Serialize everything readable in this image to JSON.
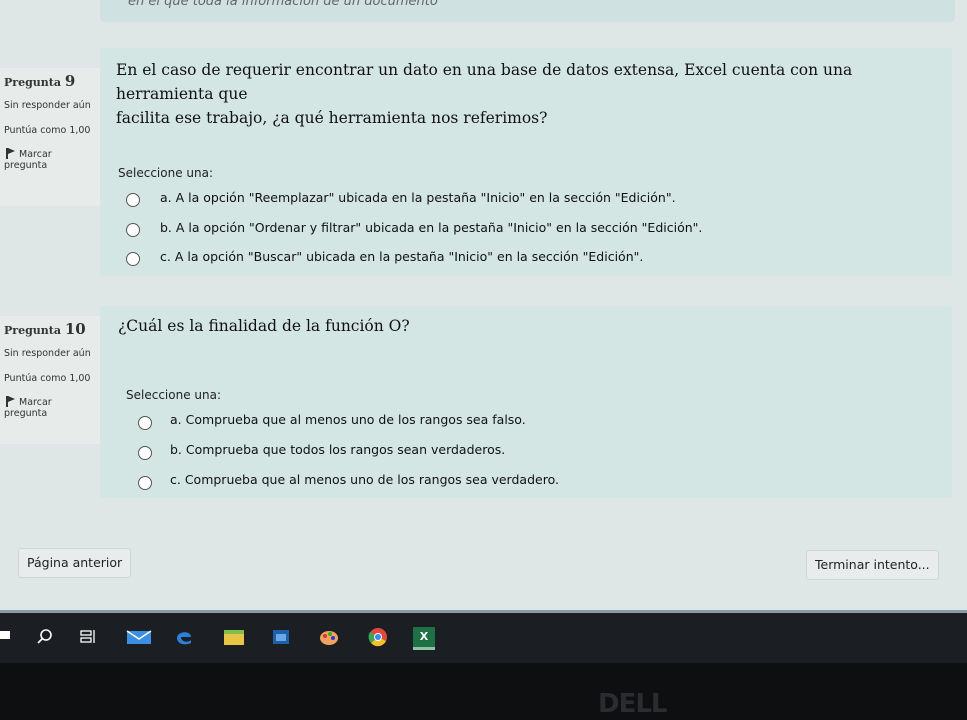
{
  "top_snippet": "en el que toda la informacion de un documento",
  "questions": [
    {
      "label": "Pregunta",
      "number": "9",
      "status": "Sin responder aún",
      "points": "Puntúa como 1,00",
      "flag_label": "Marcar",
      "flag_label2": "pregunta",
      "text_line1": "En el caso de requerir encontrar un dato en una base de datos extensa, Excel cuenta con una herramienta que",
      "text_line2": "facilita ese trabajo, ¿a qué herramienta nos referimos?",
      "prompt": "Seleccione una:",
      "options": [
        "a. A la opción \"Reemplazar\" ubicada en la pestaña \"Inicio\" en la sección \"Edición\".",
        "b. A la opción \"Ordenar y filtrar\" ubicada en la pestaña \"Inicio\" en la sección \"Edición\".",
        "c. A la opción \"Buscar\" ubicada en la pestaña \"Inicio\" en la sección \"Edición\"."
      ]
    },
    {
      "label": "Pregunta",
      "number": "10",
      "status": "Sin responder aún",
      "points": "Puntúa como 1,00",
      "flag_label": "Marcar",
      "flag_label2": "pregunta",
      "text_line1": "¿Cuál es la finalidad de la función O?",
      "prompt": "Seleccione una:",
      "options": [
        "a. Comprueba que al menos uno de los rangos sea falso.",
        "b. Comprueba que todos los rangos sean verdaderos.",
        "c. Comprueba que al menos uno de los rangos sea verdadero."
      ]
    }
  ],
  "nav": {
    "prev_label": "Página anterior",
    "finish_label": "Terminar intento..."
  },
  "taskbar": {
    "icons": [
      "windows-start-icon",
      "search-icon",
      "task-view-icon",
      "mail-icon",
      "edge-icon",
      "store-icon",
      "photos-icon",
      "paint-icon",
      "chrome-icon",
      "excel-icon"
    ],
    "excel_glyph": "X"
  },
  "bezel_brand": "DELL"
}
